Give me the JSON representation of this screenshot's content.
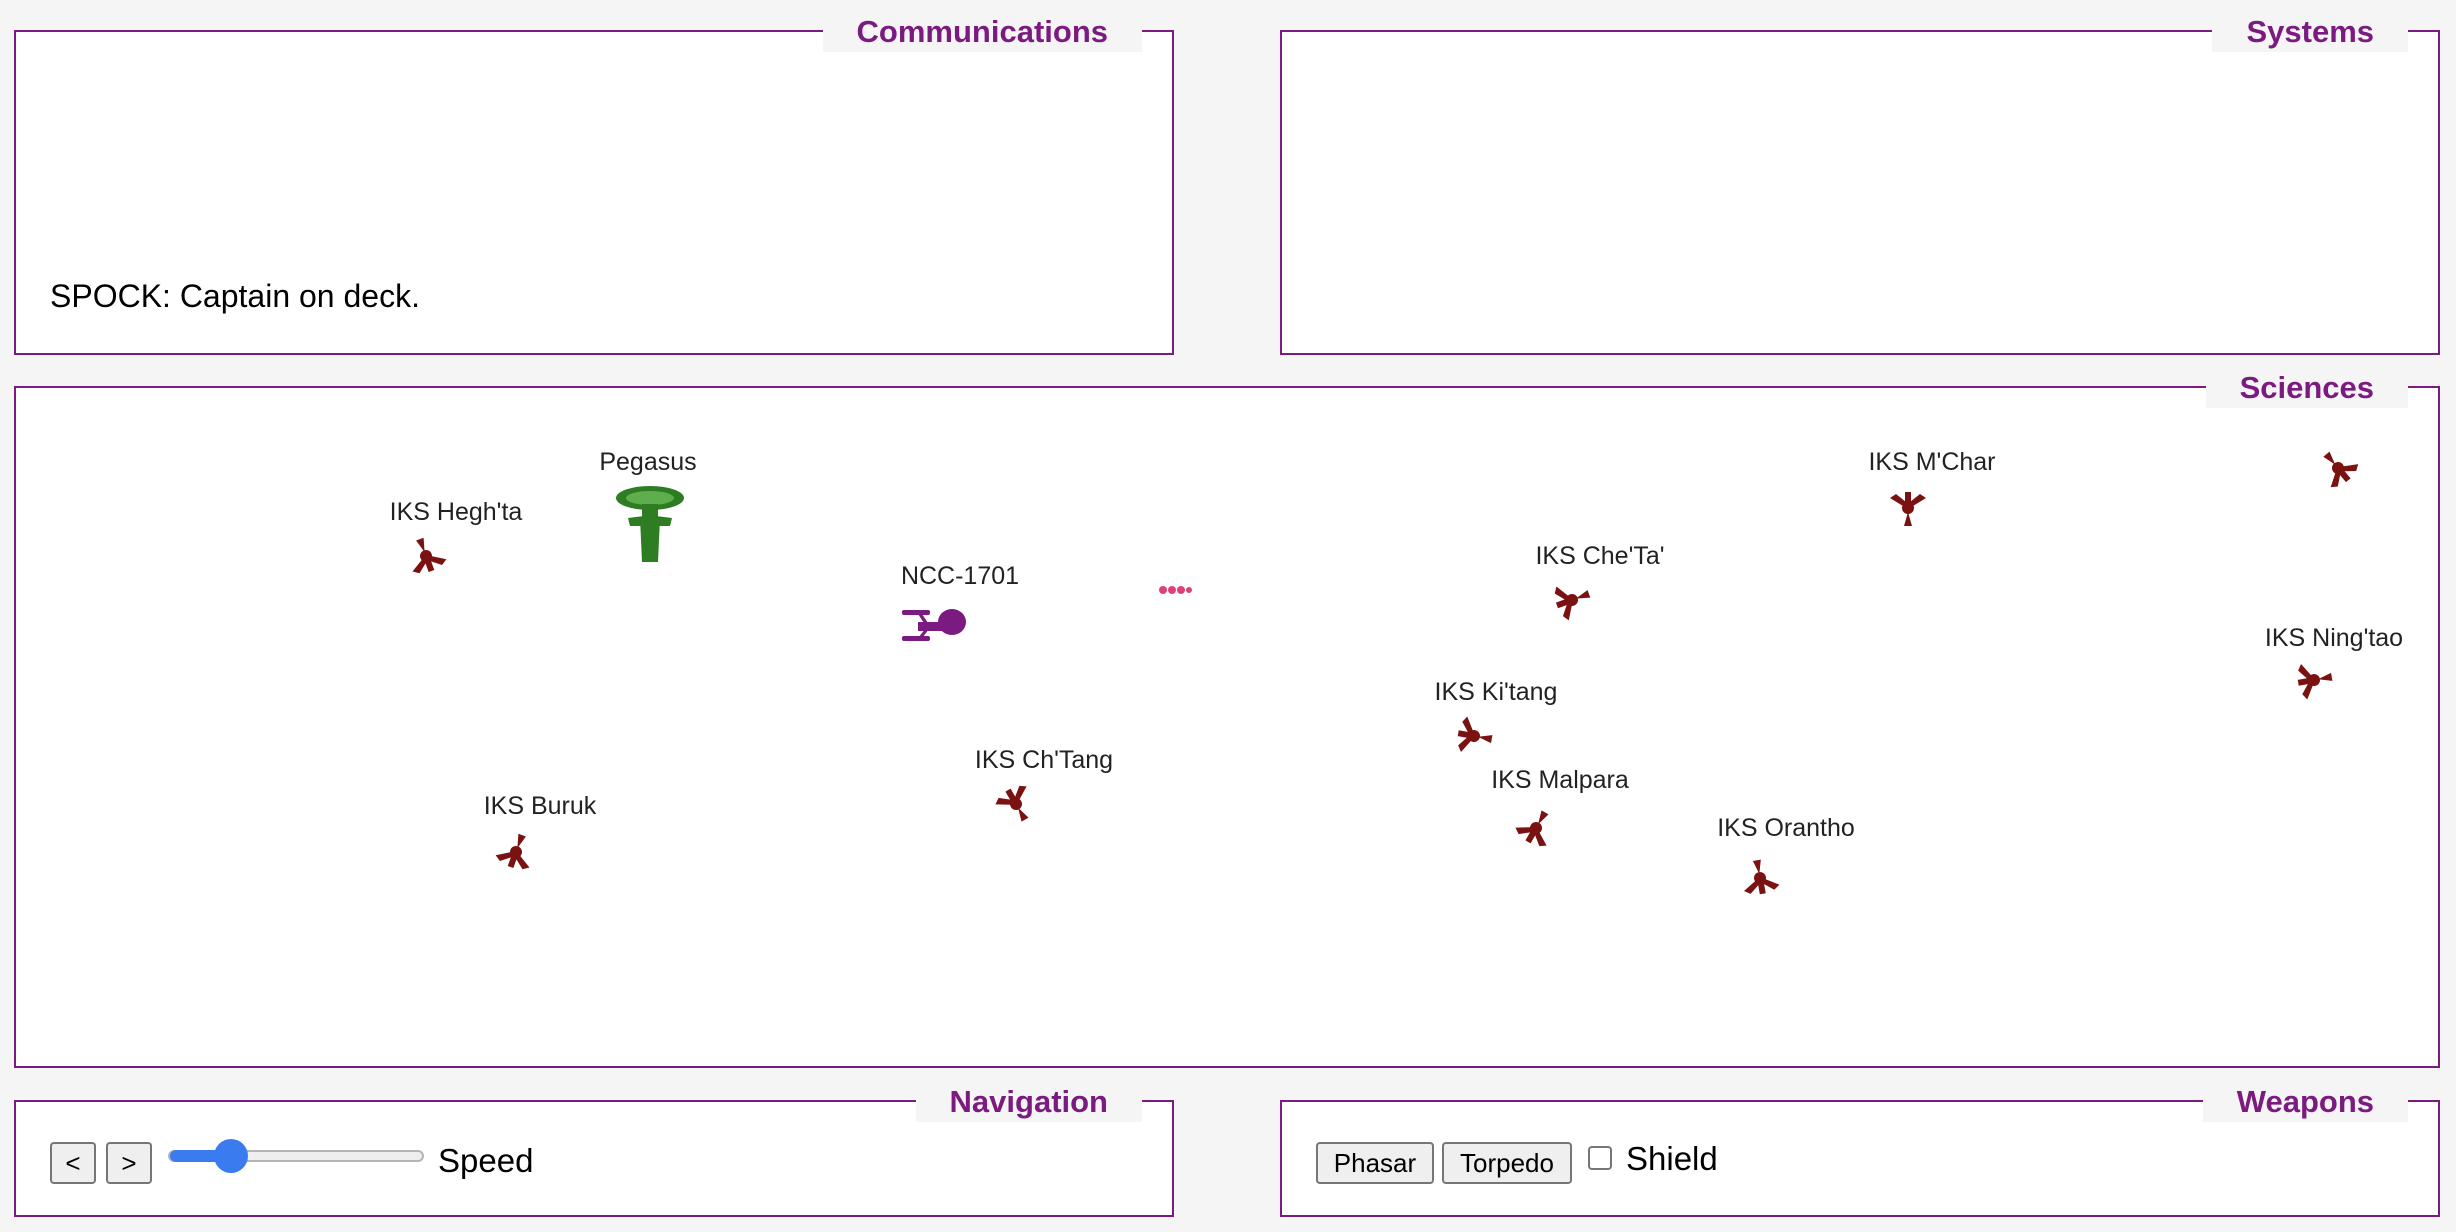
{
  "communications": {
    "title": "Communications",
    "messages": [
      "SPOCK: Captain on deck."
    ]
  },
  "systems": {
    "title": "Systems"
  },
  "sciences": {
    "title": "Sciences",
    "ships": [
      {
        "name": "IKS Hegh'ta",
        "type": "klingon",
        "color": "#7a1212"
      },
      {
        "name": "Pegasus",
        "type": "federation-green",
        "color": "#2e7d22"
      },
      {
        "name": "NCC-1701",
        "type": "enterprise",
        "color": "#7b1a80"
      },
      {
        "name": "IKS Che'Ta'",
        "type": "klingon",
        "color": "#7a1212"
      },
      {
        "name": "IKS M'Char",
        "type": "klingon",
        "color": "#7a1212"
      },
      {
        "name": "IKS Ning'tao",
        "type": "klingon",
        "color": "#7a1212"
      },
      {
        "name": "IKS Ki'tang",
        "type": "klingon",
        "color": "#7a1212"
      },
      {
        "name": "IKS Malpara",
        "type": "klingon",
        "color": "#7a1212"
      },
      {
        "name": "IKS Orantho",
        "type": "klingon",
        "color": "#7a1212"
      },
      {
        "name": "IKS Ch'Tang",
        "type": "klingon",
        "color": "#7a1212"
      },
      {
        "name": "IKS Buruk",
        "type": "klingon",
        "color": "#7a1212"
      },
      {
        "name": "",
        "type": "klingon",
        "color": "#7a1212"
      }
    ],
    "torpedo_color": "#e0407a"
  },
  "navigation": {
    "title": "Navigation",
    "left_label": "<",
    "right_label": ">",
    "speed_label": "Speed",
    "speed_fraction": 0.2
  },
  "weapons": {
    "title": "Weapons",
    "phasar_label": "Phasar",
    "torpedo_label": "Torpedo",
    "shield_label": "Shield",
    "shield_checked": false
  },
  "colors": {
    "accent": "#7b1a80",
    "slider": "#3a7bf0"
  }
}
